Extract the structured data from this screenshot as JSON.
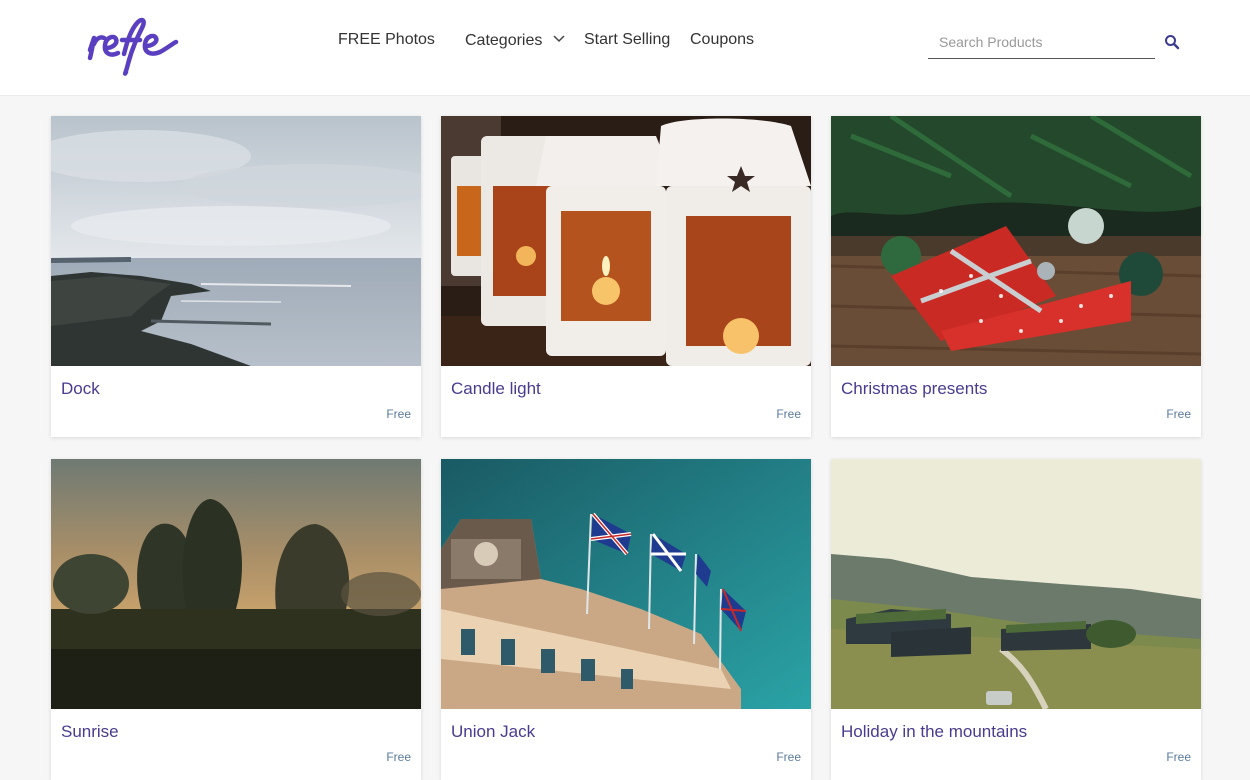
{
  "brand": {
    "logo_text": "refe",
    "accent": "#5a3fc0"
  },
  "nav": {
    "free_photos": "FREE Photos",
    "categories": "Categories",
    "start_selling": "Start Selling",
    "coupons": "Coupons"
  },
  "search": {
    "placeholder": "Search Products",
    "value": "",
    "icon": "search-icon"
  },
  "products": [
    {
      "title": "Dock",
      "price": "Free",
      "image": "dock-photo"
    },
    {
      "title": "Candle light",
      "price": "Free",
      "image": "candle-light-photo"
    },
    {
      "title": "Christmas presents",
      "price": "Free",
      "image": "christmas-presents-photo"
    },
    {
      "title": "Sunrise",
      "price": "Free",
      "image": "sunrise-photo"
    },
    {
      "title": "Union Jack",
      "price": "Free",
      "image": "union-jack-photo"
    },
    {
      "title": "Holiday in the mountains",
      "price": "Free",
      "image": "mountain-holiday-photo"
    }
  ]
}
